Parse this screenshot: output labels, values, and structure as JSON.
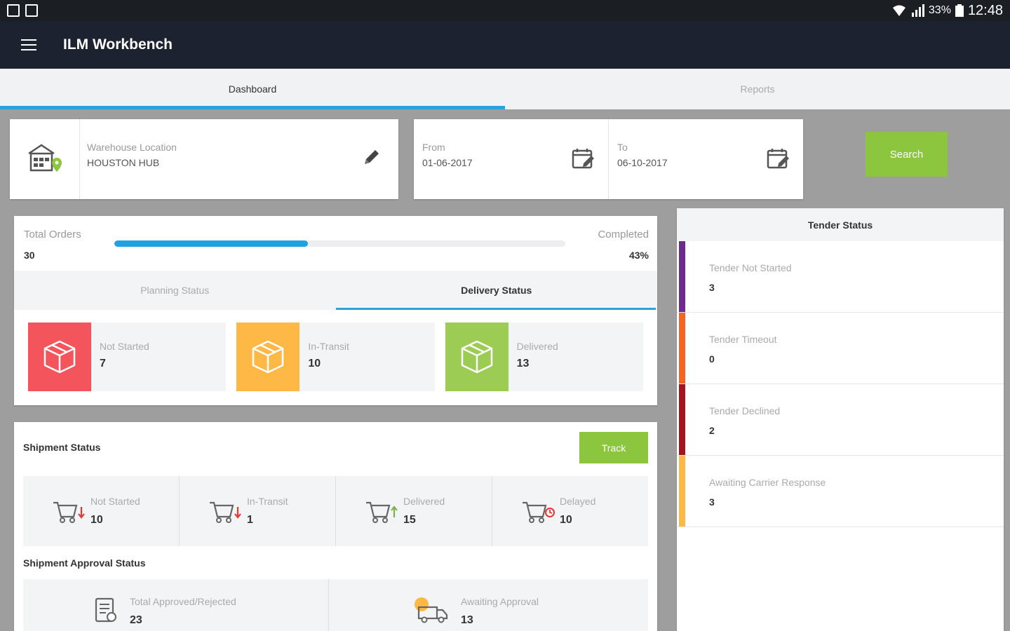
{
  "statusbar": {
    "wifi": "wifi-icon",
    "signal": "signal-icon",
    "battery_text": "33%",
    "time": "12:48"
  },
  "appbar": {
    "title": "ILM Workbench"
  },
  "tabs": [
    {
      "label": "Dashboard",
      "active": true
    },
    {
      "label": "Reports",
      "active": false
    }
  ],
  "location": {
    "label": "Warehouse Location",
    "value": "HOUSTON HUB"
  },
  "dates": {
    "from": {
      "label": "From",
      "value": "01-06-2017"
    },
    "to": {
      "label": "To",
      "value": "06-10-2017"
    }
  },
  "search": {
    "label": "Search"
  },
  "orders": {
    "total_label": "Total Orders",
    "total_value": "30",
    "completed_label": "Completed",
    "completed_value": "43%",
    "progress_fraction": 0.43
  },
  "subtabs": [
    {
      "label": "Planning Status",
      "active": false
    },
    {
      "label": "Delivery Status",
      "active": true
    }
  ],
  "delivery_tiles": [
    {
      "label": "Not Started",
      "value": "7",
      "color": "#f4545b"
    },
    {
      "label": "In-Transit",
      "value": "10",
      "color": "#fdb845"
    },
    {
      "label": "Delivered",
      "value": "13",
      "color": "#9ccc54"
    }
  ],
  "shipment": {
    "title": "Shipment Status",
    "track_label": "Track",
    "items": [
      {
        "label": "Not Started",
        "value": "10"
      },
      {
        "label": "In-Transit",
        "value": "1"
      },
      {
        "label": "Delivered",
        "value": "15"
      },
      {
        "label": "Delayed",
        "value": "10"
      }
    ],
    "approval_title": "Shipment Approval Status",
    "approval_items": [
      {
        "label": "Total Approved/Rejected",
        "value": "23"
      },
      {
        "label": "Awaiting Approval",
        "value": "13"
      }
    ]
  },
  "tender": {
    "title": "Tender Status",
    "items": [
      {
        "label": "Tender Not Started",
        "value": "3",
        "color": "#6a2c91"
      },
      {
        "label": "Tender Timeout",
        "value": "0",
        "color": "#f26522"
      },
      {
        "label": "Tender Declined",
        "value": "2",
        "color": "#a3141c"
      },
      {
        "label": "Awaiting Carrier Response",
        "value": "3",
        "color": "#fdb845"
      }
    ]
  }
}
